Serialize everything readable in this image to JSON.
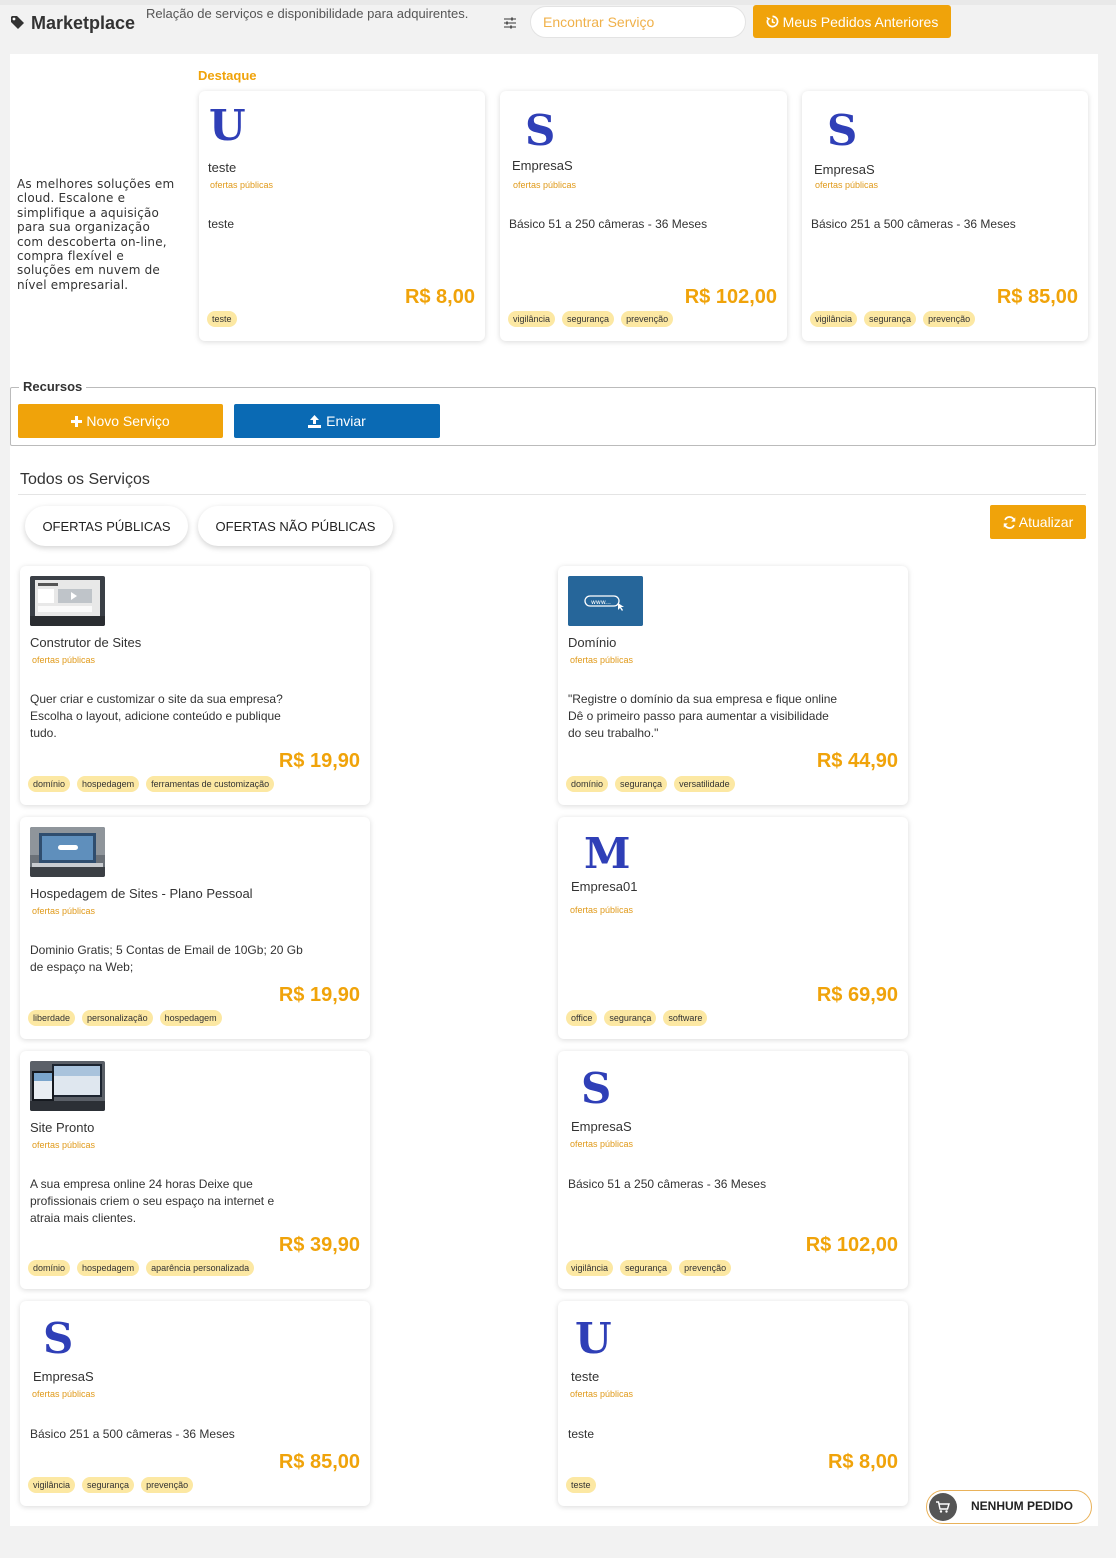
{
  "header": {
    "title": "Marketplace",
    "subtitle": "Relação de serviços e disponibilidade para adquirentes.",
    "search_placeholder": "Encontrar Serviço",
    "orders_button": "Meus Pedidos Anteriores"
  },
  "intro": {
    "text": "As melhores soluções em cloud. Escalone e simplifique a aquisição para sua organização com descoberta on-line, compra flexível e soluções em nuvem de nível empresarial."
  },
  "featured": {
    "heading": "Destaque",
    "cards": [
      {
        "letter": "U",
        "name": "teste",
        "type": "ofertas públicas",
        "description": "teste",
        "price": "R$ 8,00",
        "tags": [
          "teste"
        ]
      },
      {
        "letter": "S",
        "name": "EmpresaS",
        "type": "ofertas públicas",
        "description": "Básico 51 a 250 câmeras - 36 Meses",
        "price": "R$ 102,00",
        "tags": [
          "vigilância",
          "segurança",
          "prevenção"
        ]
      },
      {
        "letter": "S",
        "name": "EmpresaS",
        "type": "ofertas públicas",
        "description": "Básico 251 a 500 câmeras - 36 Meses",
        "price": "R$ 85,00",
        "tags": [
          "vigilância",
          "segurança",
          "prevenção"
        ]
      }
    ]
  },
  "resources": {
    "legend": "Recursos",
    "new_service": "Novo Serviço",
    "send": "Enviar"
  },
  "services": {
    "heading": "Todos os Serviços",
    "tab_public": "OFERTAS PÚBLICAS",
    "tab_private": "OFERTAS NÃO PÚBLICAS",
    "refresh": "Atualizar",
    "cards": [
      {
        "thumb": "site-builder",
        "name": "Construtor de Sites",
        "type": "ofertas públicas",
        "description": "Quer criar e customizar o site da sua empresa?\nEscolha o layout, adicione conteúdo e publique\ntudo.",
        "price": "R$ 19,90",
        "tags": [
          "domínio",
          "hospedagem",
          "ferramentas de customização"
        ]
      },
      {
        "thumb": "domain",
        "name": "Domínio",
        "type": "ofertas públicas",
        "description": "\"Registre o domínio da sua empresa e fique online\nDê o primeiro passo para aumentar a visibilidade\ndo seu trabalho.\"",
        "price": "R$ 44,90",
        "tags": [
          "domínio",
          "segurança",
          "versatilidade"
        ]
      },
      {
        "thumb": "hosting",
        "name": "Hospedagem de Sites - Plano Pessoal",
        "type": "ofertas públicas",
        "description": "Dominio Gratis; 5 Contas de Email de 10Gb; 20 Gb\nde espaço na Web;",
        "price": "R$ 19,90",
        "tags": [
          "liberdade",
          "personalização",
          "hospedagem"
        ]
      },
      {
        "letter": "M",
        "name": "Empresa01",
        "type": "ofertas públicas",
        "description": "",
        "price": "R$ 69,90",
        "tags": [
          "office",
          "segurança",
          "software"
        ]
      },
      {
        "thumb": "ready-site",
        "name": "Site Pronto",
        "type": "ofertas públicas",
        "description": "A sua empresa online 24 horas Deixe que\nprofissionais criem o seu espaço na internet e\natraia mais clientes.",
        "price": "R$ 39,90",
        "tags": [
          "domínio",
          "hospedagem",
          "aparência personalizada"
        ]
      },
      {
        "letter": "S",
        "name": "EmpresaS",
        "type": "ofertas públicas",
        "description": "Básico 51 a 250 câmeras - 36 Meses",
        "price": "R$ 102,00",
        "tags": [
          "vigilância",
          "segurança",
          "prevenção"
        ]
      },
      {
        "letter": "S",
        "name": "EmpresaS",
        "type": "ofertas públicas",
        "description": "Básico 251 a 500 câmeras - 36 Meses",
        "price": "R$ 85,00",
        "tags": [
          "vigilância",
          "segurança",
          "prevenção"
        ]
      },
      {
        "letter": "U",
        "name": "teste",
        "type": "ofertas públicas",
        "description": "teste",
        "price": "R$ 8,00",
        "tags": [
          "teste"
        ]
      }
    ]
  },
  "cart": {
    "label": "NENHUM PEDIDO"
  },
  "colors": {
    "accent": "#f0a30a",
    "primary": "#0a6ab4",
    "letter": "#2f3fb7",
    "chip": "#fce8a3"
  }
}
